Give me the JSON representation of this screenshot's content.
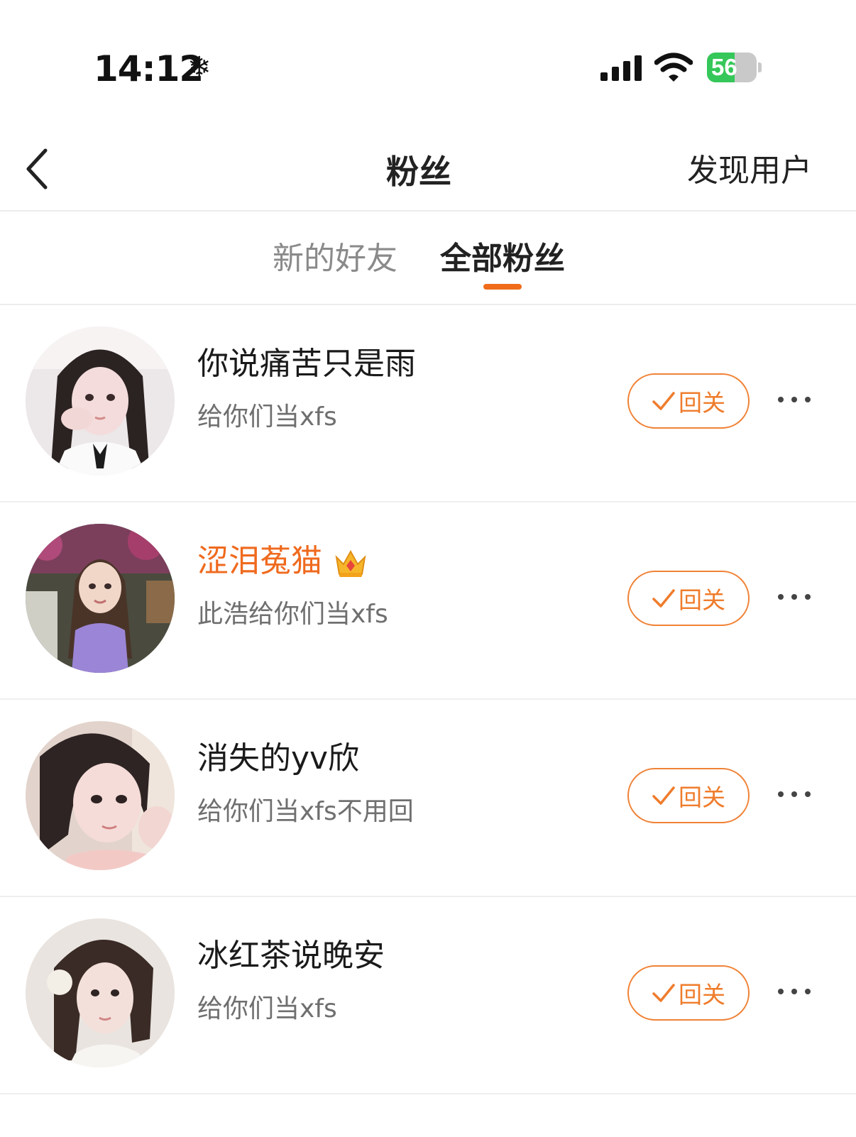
{
  "status_bar": {
    "time": "14:12",
    "snow_icon": "❄",
    "battery_percent": "56",
    "battery_level": 0.56
  },
  "nav": {
    "title": "粉丝",
    "right_action": "发现用户"
  },
  "tabs": [
    {
      "label": "新的好友",
      "active": false
    },
    {
      "label": "全部粉丝",
      "active": true
    }
  ],
  "followers": [
    {
      "name": "你说痛苦只是雨",
      "desc": "给你们当xfs",
      "button": "回关",
      "vip": false
    },
    {
      "name": "涩泪菟猫",
      "desc": "此浩给你们当xfs",
      "button": "回关",
      "vip": true
    },
    {
      "name": "消失的yv欣",
      "desc": "给你们当xfs不用回",
      "button": "回关",
      "vip": false
    },
    {
      "name": "冰红茶说晚安",
      "desc": "给你们当xfs",
      "button": "回关",
      "vip": false
    }
  ],
  "colors": {
    "accent": "#f06c1a",
    "button_border": "#f08236",
    "vip_name": "#ef6a1e",
    "battery_green": "#35c759"
  }
}
